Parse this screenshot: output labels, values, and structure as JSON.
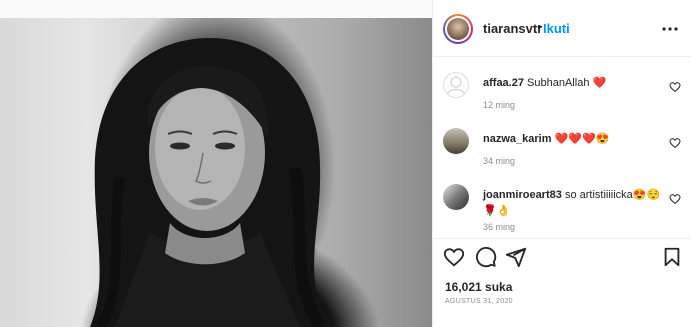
{
  "post": {
    "username": "tiaransvtr",
    "separator": "•",
    "follow_label": "Ikuti",
    "likes": "16,021 suka",
    "date": "AGUSTUS 31, 2020"
  },
  "comments": [
    {
      "user": "affaa.27",
      "text": "SubhanAllah ❤️",
      "time": "12 ming",
      "avatar": "default-avatar"
    },
    {
      "user": "nazwa_karim",
      "text": "❤️❤️❤️😍",
      "time": "34 ming",
      "avatar": "photo-avatar"
    },
    {
      "user": "joanmiroeart83",
      "text": "so artistiiiiicka😍😌",
      "line2": "🌹👌",
      "time": "36 ming",
      "avatar": "photo-avatar"
    }
  ],
  "icons": {
    "more": "more-options-icon",
    "heart": "heart-icon",
    "comment": "comment-icon",
    "share": "send-icon",
    "save": "bookmark-icon"
  },
  "colors": {
    "follow": "#0095f6",
    "muted": "#8e8e8e",
    "text": "#262626"
  }
}
